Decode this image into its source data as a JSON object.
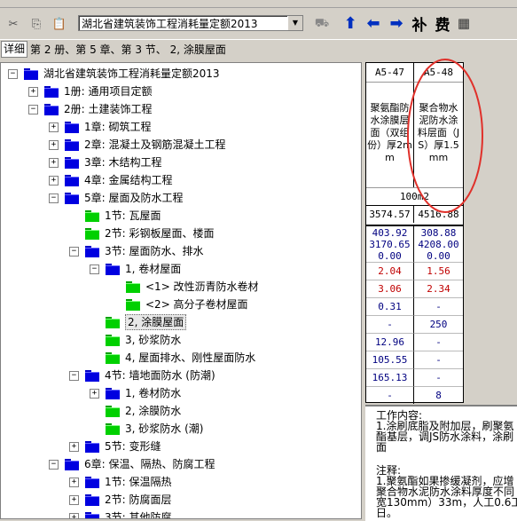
{
  "toolbar": {
    "combo_value": "湖北省建筑装饰工程消耗量定额2013",
    "buttons": [
      "up-arrow",
      "left-arrow",
      "right-arrow"
    ],
    "supplement_label": "补",
    "fee_label": "费"
  },
  "pathbar": {
    "detail_tab": "详细",
    "path": "第 2 册、第 5 章、第 3 节、 2, 涂膜屋面"
  },
  "tree": [
    {
      "level": 0,
      "exp": "-",
      "color": "blue",
      "label": "湖北省建筑装饰工程消耗量定额2013"
    },
    {
      "level": 1,
      "exp": "+",
      "color": "blue",
      "label": "1册: 通用项目定额"
    },
    {
      "level": 1,
      "exp": "-",
      "color": "blue",
      "label": "2册: 土建装饰工程"
    },
    {
      "level": 2,
      "exp": "+",
      "color": "blue",
      "label": "1章: 砌筑工程"
    },
    {
      "level": 2,
      "exp": "+",
      "color": "blue",
      "label": "2章: 混凝土及钢筋混凝土工程"
    },
    {
      "level": 2,
      "exp": "+",
      "color": "blue",
      "label": "3章: 木结构工程"
    },
    {
      "level": 2,
      "exp": "+",
      "color": "blue",
      "label": "4章: 金属结构工程"
    },
    {
      "level": 2,
      "exp": "-",
      "color": "blue",
      "label": "5章: 屋面及防水工程"
    },
    {
      "level": 3,
      "exp": "",
      "color": "green",
      "label": "1节: 瓦屋面"
    },
    {
      "level": 3,
      "exp": "",
      "color": "green",
      "label": "2节: 彩钢板屋面、楼面"
    },
    {
      "level": 3,
      "exp": "-",
      "color": "blue",
      "label": "3节: 屋面防水、排水"
    },
    {
      "level": 4,
      "exp": "-",
      "color": "blue",
      "label": "1, 卷材屋面"
    },
    {
      "level": 5,
      "exp": "",
      "color": "green",
      "label": "<1> 改性沥青防水卷材"
    },
    {
      "level": 5,
      "exp": "",
      "color": "green",
      "label": "<2> 高分子卷材屋面"
    },
    {
      "level": 4,
      "exp": "",
      "color": "green",
      "label": "2, 涂膜屋面",
      "selected": true
    },
    {
      "level": 4,
      "exp": "",
      "color": "green",
      "label": "3, 砂浆防水"
    },
    {
      "level": 4,
      "exp": "",
      "color": "green",
      "label": "4, 屋面排水、刚性屋面防水"
    },
    {
      "level": 3,
      "exp": "-",
      "color": "blue",
      "label": "4节: 墙地面防水 (防潮)"
    },
    {
      "level": 4,
      "exp": "+",
      "color": "blue",
      "label": "1, 卷材防水"
    },
    {
      "level": 4,
      "exp": "",
      "color": "green",
      "label": "2, 涂膜防水"
    },
    {
      "level": 4,
      "exp": "",
      "color": "green",
      "label": "3, 砂浆防水 (潮)"
    },
    {
      "level": 3,
      "exp": "+",
      "color": "blue",
      "label": "5节: 变形缝"
    },
    {
      "level": 2,
      "exp": "-",
      "color": "blue",
      "label": "6章: 保温、隔热、防腐工程"
    },
    {
      "level": 3,
      "exp": "+",
      "color": "blue",
      "label": "1节: 保温隔热"
    },
    {
      "level": 3,
      "exp": "+",
      "color": "blue",
      "label": "2节: 防腐面层"
    },
    {
      "level": 3,
      "exp": "+",
      "color": "blue",
      "label": "3节: 其他防腐"
    }
  ],
  "grid": {
    "codes": [
      "A5-47",
      "A5-48"
    ],
    "names": [
      "聚氨酯防水涂膜层面（双组份）厚2mm",
      "聚合物水泥防水涂料层面（JS）厚1.5mm"
    ],
    "unit": "100m2",
    "prices": [
      "3574.57",
      "4516.88"
    ],
    "breakdown": [
      [
        "403.92",
        "3170.65",
        "0.00"
      ],
      [
        "308.88",
        "4208.00",
        "0.00"
      ]
    ],
    "rows": [
      [
        "2.04",
        "1.56"
      ],
      [
        "3.06",
        "2.34"
      ],
      [
        "0.31",
        "-"
      ],
      [
        "-",
        "250"
      ],
      [
        "12.96",
        "-"
      ],
      [
        "105.55",
        "-"
      ],
      [
        "165.13",
        "-"
      ],
      [
        "-",
        "8"
      ]
    ]
  },
  "notes": {
    "work_title": "工作内容:",
    "work_text": "1.涂刷底脂及附加层，刷聚氨酯基层，调JS防水涂料，涂刷面",
    "note_title": "注释:",
    "note_text": "1.聚氨酯如果掺缓凝剂，应增聚合物水泥防水涂料厚度不同宽130mm）33m，人工0.6工日。"
  },
  "colors": {
    "accent_red": "#c00000",
    "annotation_circle": "#e0302a",
    "folder_blue": "#0000e0",
    "folder_green": "#00d000"
  }
}
